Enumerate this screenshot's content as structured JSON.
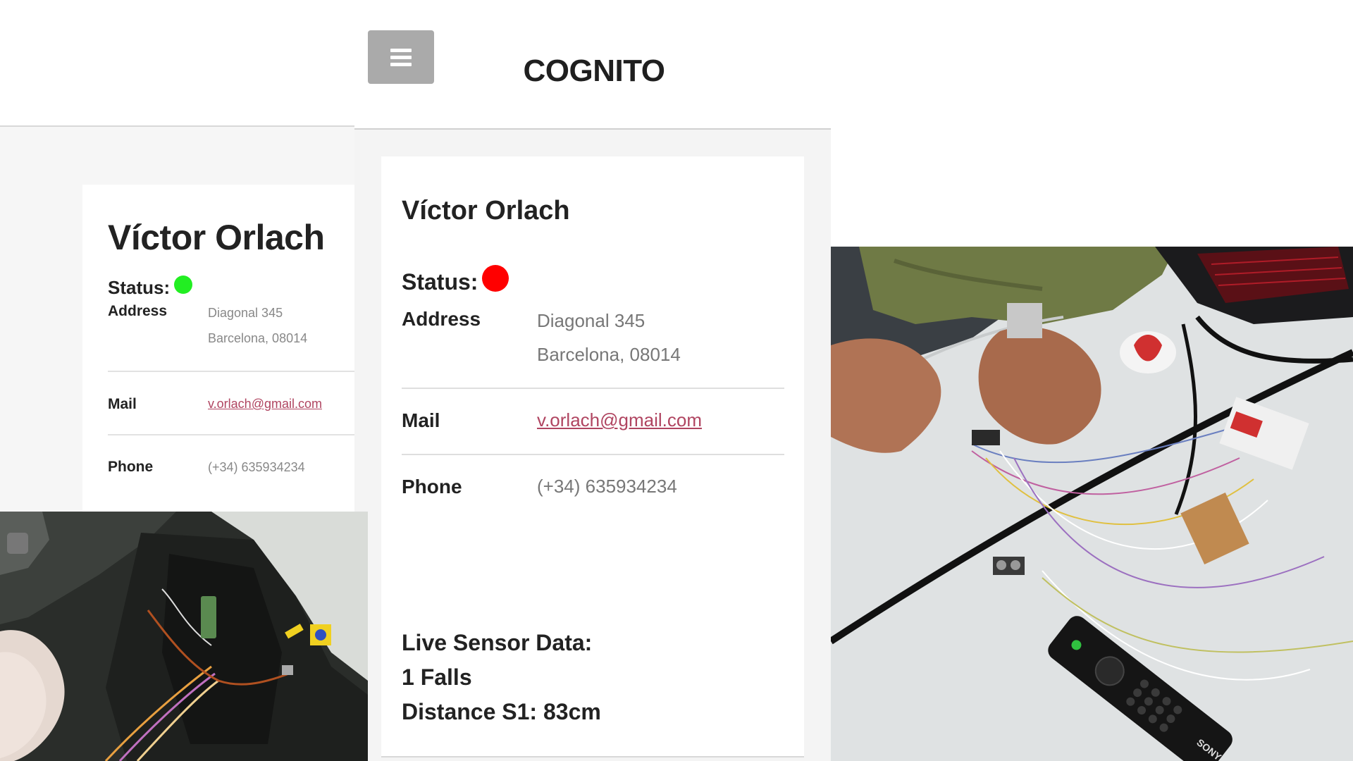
{
  "brand": "COGNITO",
  "left_card": {
    "name": "Víctor Orlach",
    "status_label": "Status:",
    "status_color": "#22ee22",
    "address_label": "Address",
    "address_line1": "Diagonal 345",
    "address_line2": "Barcelona, 08014",
    "mail_label": "Mail",
    "mail_value": "v.orlach@gmail.com",
    "phone_label": "Phone",
    "phone_value": "(+34) 635934234"
  },
  "center_card": {
    "name": "Víctor Orlach",
    "status_label": "Status:",
    "status_color": "#ff0000",
    "address_label": "Address",
    "address_line1": "Diagonal 345",
    "address_line2": "Barcelona, 08014",
    "mail_label": "Mail",
    "mail_value": "v.orlach@gmail.com",
    "phone_label": "Phone",
    "phone_value": "(+34) 635934234",
    "sensor_title": "Live Sensor Data:",
    "sensor_falls": "1 Falls",
    "sensor_distance": "Distance S1: 83cm"
  },
  "icons": {
    "menu": "hamburger-menu-icon"
  },
  "photo_brand_text": "SONY"
}
